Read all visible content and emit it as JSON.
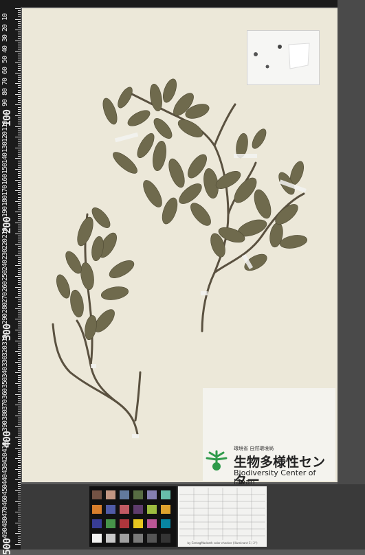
{
  "ruler": {
    "numbers": [
      "10",
      "20",
      "30",
      "40",
      "50",
      "60",
      "70",
      "80",
      "90",
      "100",
      "110",
      "120",
      "130",
      "140",
      "150",
      "160",
      "170",
      "180",
      "190",
      "200",
      "210",
      "220",
      "230",
      "240",
      "250",
      "260",
      "270",
      "280",
      "290",
      "300",
      "310",
      "320",
      "330",
      "340",
      "350",
      "360",
      "370",
      "380",
      "390",
      "400",
      "410",
      "420",
      "430",
      "440",
      "450",
      "460",
      "470",
      "480",
      "490",
      "500"
    ]
  },
  "label": {
    "agency": "環境省 自然環境局",
    "name_ja": "生物多様性センター",
    "name_en": "Biodiversity Center of Japan"
  },
  "color_table": {
    "caption": "by GretagMacbeth color checker (Illuminant C / 2°)"
  },
  "colors": {
    "sheet": "#ece8d9",
    "leaf": "#6f6a4d",
    "logo_green": "#2e9a4a"
  }
}
